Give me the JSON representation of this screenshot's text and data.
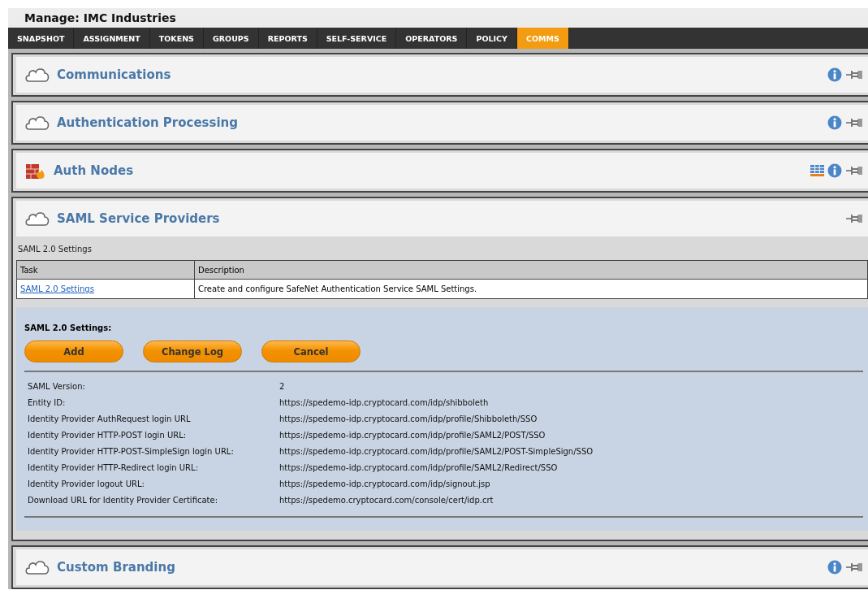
{
  "header": {
    "title": "Manage: IMC Industries"
  },
  "tabs": [
    {
      "label": "SNAPSHOT",
      "selected": false
    },
    {
      "label": "ASSIGNMENT",
      "selected": false
    },
    {
      "label": "TOKENS",
      "selected": false
    },
    {
      "label": "GROUPS",
      "selected": false
    },
    {
      "label": "REPORTS",
      "selected": false
    },
    {
      "label": "SELF-SERVICE",
      "selected": false
    },
    {
      "label": "OPERATORS",
      "selected": false
    },
    {
      "label": "POLICY",
      "selected": false
    },
    {
      "label": "COMMS",
      "selected": true
    }
  ],
  "panels": [
    {
      "title": "Communications",
      "kind": "cloud",
      "grid_view": false,
      "info": true
    },
    {
      "title": "Authentication Processing",
      "kind": "cloud",
      "grid_view": false,
      "info": true
    },
    {
      "title": "Auth Nodes",
      "kind": "firewall",
      "grid_view": true,
      "info": true
    },
    {
      "title": "SAML Service Providers",
      "kind": "cloud",
      "grid_view": false,
      "info": false,
      "body": {
        "subtitle": "SAML 2.0 Settings",
        "table": {
          "columns": [
            "Task",
            "Description"
          ],
          "rows": [
            {
              "task": "SAML 2.0 Settings",
              "description": "Create and configure SafeNet Authentication Service SAML Settings."
            }
          ]
        },
        "settings": {
          "title": "SAML 2.0 Settings:",
          "buttons": [
            "Add",
            "Change Log",
            "Cancel"
          ],
          "fields": [
            {
              "label": "SAML Version:",
              "value": "2"
            },
            {
              "label": "Entity ID:",
              "value": "https://spedemo-idp.cryptocard.com/idp/shibboleth"
            },
            {
              "label": "Identity Provider AuthRequest login URL",
              "value": "https://spedemo-idp.cryptocard.com/idp/profile/Shibboleth/SSO"
            },
            {
              "label": "Identity Provider HTTP-POST login URL:",
              "value": "https://spedemo-idp.cryptocard.com/idp/profile/SAML2/POST/SSO"
            },
            {
              "label": "Identity Provider HTTP-POST-SimpleSign login URL:",
              "value": "https://spedemo-idp.cryptocard.com/idp/profile/SAML2/POST-SimpleSign/SSO"
            },
            {
              "label": "Identity Provider HTTP-Redirect login URL:",
              "value": "https://spedemo-idp.cryptocard.com/idp/profile/SAML2/Redirect/SSO"
            },
            {
              "label": "Identity Provider logout URL:",
              "value": "https://spedemo-idp.cryptocard.com/idp/signout.jsp"
            },
            {
              "label": "Download URL for Identity Provider Certificate:",
              "value": "https://spedemo.cryptocard.com/console/cert/idp.crt"
            }
          ]
        }
      }
    },
    {
      "title": "Custom Branding",
      "kind": "cloud",
      "grid_view": false,
      "info": true
    }
  ]
}
